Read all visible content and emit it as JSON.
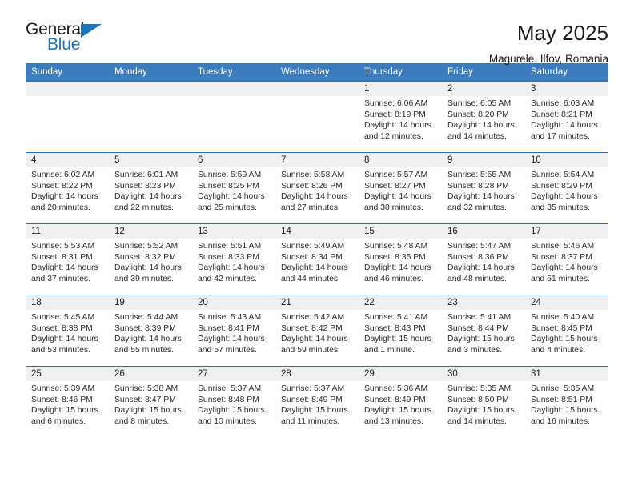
{
  "brand": {
    "word_one": "General",
    "word_two": "Blue",
    "triangle_color": "#1b75bb"
  },
  "header": {
    "month_title": "May 2025",
    "location": "Magurele, Ilfov, Romania"
  },
  "theme": {
    "header_row_bg": "#3a7cbe",
    "row_divider": "#2f6fae",
    "daynum_strip_bg": "#f0f0f0"
  },
  "calendar": {
    "weekday_headers": [
      "Sunday",
      "Monday",
      "Tuesday",
      "Wednesday",
      "Thursday",
      "Friday",
      "Saturday"
    ],
    "weeks": [
      [
        {
          "day": "",
          "sunrise": "",
          "sunset": "",
          "daylight_line1": "",
          "daylight_line2": ""
        },
        {
          "day": "",
          "sunrise": "",
          "sunset": "",
          "daylight_line1": "",
          "daylight_line2": ""
        },
        {
          "day": "",
          "sunrise": "",
          "sunset": "",
          "daylight_line1": "",
          "daylight_line2": ""
        },
        {
          "day": "",
          "sunrise": "",
          "sunset": "",
          "daylight_line1": "",
          "daylight_line2": ""
        },
        {
          "day": "1",
          "sunrise": "Sunrise: 6:06 AM",
          "sunset": "Sunset: 8:19 PM",
          "daylight_line1": "Daylight: 14 hours",
          "daylight_line2": "and 12 minutes."
        },
        {
          "day": "2",
          "sunrise": "Sunrise: 6:05 AM",
          "sunset": "Sunset: 8:20 PM",
          "daylight_line1": "Daylight: 14 hours",
          "daylight_line2": "and 14 minutes."
        },
        {
          "day": "3",
          "sunrise": "Sunrise: 6:03 AM",
          "sunset": "Sunset: 8:21 PM",
          "daylight_line1": "Daylight: 14 hours",
          "daylight_line2": "and 17 minutes."
        }
      ],
      [
        {
          "day": "4",
          "sunrise": "Sunrise: 6:02 AM",
          "sunset": "Sunset: 8:22 PM",
          "daylight_line1": "Daylight: 14 hours",
          "daylight_line2": "and 20 minutes."
        },
        {
          "day": "5",
          "sunrise": "Sunrise: 6:01 AM",
          "sunset": "Sunset: 8:23 PM",
          "daylight_line1": "Daylight: 14 hours",
          "daylight_line2": "and 22 minutes."
        },
        {
          "day": "6",
          "sunrise": "Sunrise: 5:59 AM",
          "sunset": "Sunset: 8:25 PM",
          "daylight_line1": "Daylight: 14 hours",
          "daylight_line2": "and 25 minutes."
        },
        {
          "day": "7",
          "sunrise": "Sunrise: 5:58 AM",
          "sunset": "Sunset: 8:26 PM",
          "daylight_line1": "Daylight: 14 hours",
          "daylight_line2": "and 27 minutes."
        },
        {
          "day": "8",
          "sunrise": "Sunrise: 5:57 AM",
          "sunset": "Sunset: 8:27 PM",
          "daylight_line1": "Daylight: 14 hours",
          "daylight_line2": "and 30 minutes."
        },
        {
          "day": "9",
          "sunrise": "Sunrise: 5:55 AM",
          "sunset": "Sunset: 8:28 PM",
          "daylight_line1": "Daylight: 14 hours",
          "daylight_line2": "and 32 minutes."
        },
        {
          "day": "10",
          "sunrise": "Sunrise: 5:54 AM",
          "sunset": "Sunset: 8:29 PM",
          "daylight_line1": "Daylight: 14 hours",
          "daylight_line2": "and 35 minutes."
        }
      ],
      [
        {
          "day": "11",
          "sunrise": "Sunrise: 5:53 AM",
          "sunset": "Sunset: 8:31 PM",
          "daylight_line1": "Daylight: 14 hours",
          "daylight_line2": "and 37 minutes."
        },
        {
          "day": "12",
          "sunrise": "Sunrise: 5:52 AM",
          "sunset": "Sunset: 8:32 PM",
          "daylight_line1": "Daylight: 14 hours",
          "daylight_line2": "and 39 minutes."
        },
        {
          "day": "13",
          "sunrise": "Sunrise: 5:51 AM",
          "sunset": "Sunset: 8:33 PM",
          "daylight_line1": "Daylight: 14 hours",
          "daylight_line2": "and 42 minutes."
        },
        {
          "day": "14",
          "sunrise": "Sunrise: 5:49 AM",
          "sunset": "Sunset: 8:34 PM",
          "daylight_line1": "Daylight: 14 hours",
          "daylight_line2": "and 44 minutes."
        },
        {
          "day": "15",
          "sunrise": "Sunrise: 5:48 AM",
          "sunset": "Sunset: 8:35 PM",
          "daylight_line1": "Daylight: 14 hours",
          "daylight_line2": "and 46 minutes."
        },
        {
          "day": "16",
          "sunrise": "Sunrise: 5:47 AM",
          "sunset": "Sunset: 8:36 PM",
          "daylight_line1": "Daylight: 14 hours",
          "daylight_line2": "and 48 minutes."
        },
        {
          "day": "17",
          "sunrise": "Sunrise: 5:46 AM",
          "sunset": "Sunset: 8:37 PM",
          "daylight_line1": "Daylight: 14 hours",
          "daylight_line2": "and 51 minutes."
        }
      ],
      [
        {
          "day": "18",
          "sunrise": "Sunrise: 5:45 AM",
          "sunset": "Sunset: 8:38 PM",
          "daylight_line1": "Daylight: 14 hours",
          "daylight_line2": "and 53 minutes."
        },
        {
          "day": "19",
          "sunrise": "Sunrise: 5:44 AM",
          "sunset": "Sunset: 8:39 PM",
          "daylight_line1": "Daylight: 14 hours",
          "daylight_line2": "and 55 minutes."
        },
        {
          "day": "20",
          "sunrise": "Sunrise: 5:43 AM",
          "sunset": "Sunset: 8:41 PM",
          "daylight_line1": "Daylight: 14 hours",
          "daylight_line2": "and 57 minutes."
        },
        {
          "day": "21",
          "sunrise": "Sunrise: 5:42 AM",
          "sunset": "Sunset: 8:42 PM",
          "daylight_line1": "Daylight: 14 hours",
          "daylight_line2": "and 59 minutes."
        },
        {
          "day": "22",
          "sunrise": "Sunrise: 5:41 AM",
          "sunset": "Sunset: 8:43 PM",
          "daylight_line1": "Daylight: 15 hours",
          "daylight_line2": "and 1 minute."
        },
        {
          "day": "23",
          "sunrise": "Sunrise: 5:41 AM",
          "sunset": "Sunset: 8:44 PM",
          "daylight_line1": "Daylight: 15 hours",
          "daylight_line2": "and 3 minutes."
        },
        {
          "day": "24",
          "sunrise": "Sunrise: 5:40 AM",
          "sunset": "Sunset: 8:45 PM",
          "daylight_line1": "Daylight: 15 hours",
          "daylight_line2": "and 4 minutes."
        }
      ],
      [
        {
          "day": "25",
          "sunrise": "Sunrise: 5:39 AM",
          "sunset": "Sunset: 8:46 PM",
          "daylight_line1": "Daylight: 15 hours",
          "daylight_line2": "and 6 minutes."
        },
        {
          "day": "26",
          "sunrise": "Sunrise: 5:38 AM",
          "sunset": "Sunset: 8:47 PM",
          "daylight_line1": "Daylight: 15 hours",
          "daylight_line2": "and 8 minutes."
        },
        {
          "day": "27",
          "sunrise": "Sunrise: 5:37 AM",
          "sunset": "Sunset: 8:48 PM",
          "daylight_line1": "Daylight: 15 hours",
          "daylight_line2": "and 10 minutes."
        },
        {
          "day": "28",
          "sunrise": "Sunrise: 5:37 AM",
          "sunset": "Sunset: 8:49 PM",
          "daylight_line1": "Daylight: 15 hours",
          "daylight_line2": "and 11 minutes."
        },
        {
          "day": "29",
          "sunrise": "Sunrise: 5:36 AM",
          "sunset": "Sunset: 8:49 PM",
          "daylight_line1": "Daylight: 15 hours",
          "daylight_line2": "and 13 minutes."
        },
        {
          "day": "30",
          "sunrise": "Sunrise: 5:35 AM",
          "sunset": "Sunset: 8:50 PM",
          "daylight_line1": "Daylight: 15 hours",
          "daylight_line2": "and 14 minutes."
        },
        {
          "day": "31",
          "sunrise": "Sunrise: 5:35 AM",
          "sunset": "Sunset: 8:51 PM",
          "daylight_line1": "Daylight: 15 hours",
          "daylight_line2": "and 16 minutes."
        }
      ]
    ]
  }
}
